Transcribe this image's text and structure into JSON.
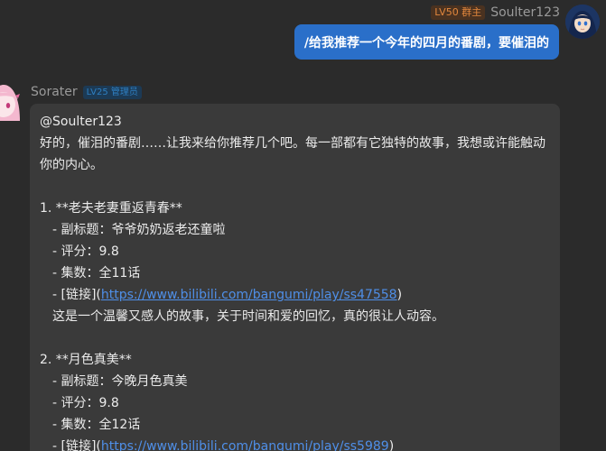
{
  "outgoing": {
    "badge": "LV50 群主",
    "username": "Soulter123",
    "text": "/给我推荐一个今年的四月的番剧，要催泪的"
  },
  "incoming": {
    "username": "Sorater",
    "badge": "LV25 管理员",
    "mention": "@Soulter123",
    "intro": "好的，催泪的番剧……让我来给你推荐几个吧。每一部都有它独特的故事，我想或许能触动你的内心。",
    "items": [
      {
        "title_line": "1. **老夫老妻重返青春**",
        "subtitle_line": "- 副标题：爷爷奶奶返老还童啦",
        "rating_line": "- 评分：9.8",
        "episodes_line": "- 集数：全11话",
        "link_prefix": "- [链接](",
        "link_url": "https://www.bilibili.com/bangumi/play/ss47558",
        "link_suffix": ")",
        "description": "这是一个温馨又感人的故事，关于时间和爱的回忆，真的很让人动容。"
      },
      {
        "title_line": "2. **月色真美**",
        "subtitle_line": "- 副标题：今晚月色真美",
        "rating_line": "- 评分：9.8",
        "episodes_line": "- 集数：全12话",
        "link_prefix": "- [链接](",
        "link_url": "https://www.bilibili.com/bangumi/play/ss5989",
        "link_suffix": ")"
      }
    ]
  },
  "colors": {
    "background": "#2b2b2b",
    "outgoing_bubble": "#2a6fc9",
    "incoming_bubble": "#3a3a3a",
    "owner_badge": "#e2873d",
    "admin_badge": "#2e7fc2",
    "link": "#4f8fe8"
  },
  "icons": {
    "self_avatar": "anime-girl-avatar-icon",
    "bot_avatar": "pink-anime-avatar-icon"
  }
}
